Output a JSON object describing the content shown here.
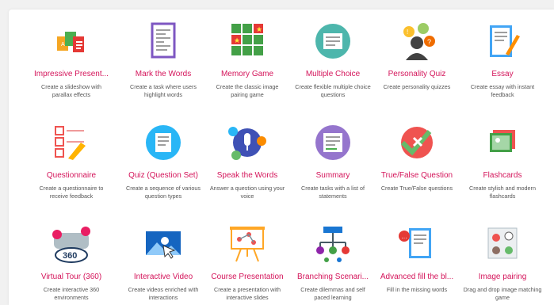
{
  "content_types": [
    {
      "icon": "presentation-icon",
      "title": "Impressive Present...",
      "desc": "Create a slideshow with parallax effects"
    },
    {
      "icon": "mark-words-icon",
      "title": "Mark the Words",
      "desc": "Create a task where users highlight words"
    },
    {
      "icon": "memory-game-icon",
      "title": "Memory Game",
      "desc": "Create the classic image pairing game"
    },
    {
      "icon": "multiple-choice-icon",
      "title": "Multiple Choice",
      "desc": "Create flexible multiple choice questions"
    },
    {
      "icon": "personality-quiz-icon",
      "title": "Personality Quiz",
      "desc": "Create personality quizzes"
    },
    {
      "icon": "essay-icon",
      "title": "Essay",
      "desc": "Create essay with instant feedback"
    },
    {
      "icon": "questionnaire-icon",
      "title": "Questionnaire",
      "desc": "Create a questionnaire to receive feedback"
    },
    {
      "icon": "question-set-icon",
      "title": "Quiz (Question Set)",
      "desc": "Create a sequence of various question types"
    },
    {
      "icon": "speak-words-icon",
      "title": "Speak the Words",
      "desc": "Answer a question using your voice"
    },
    {
      "icon": "summary-icon",
      "title": "Summary",
      "desc": "Create tasks with a list of statements"
    },
    {
      "icon": "true-false-icon",
      "title": "True/False Question",
      "desc": "Create True/False questions"
    },
    {
      "icon": "flashcards-icon",
      "title": "Flashcards",
      "desc": "Create stylish and modern flashcards"
    },
    {
      "icon": "virtual-tour-icon",
      "title": "Virtual Tour (360)",
      "desc": "Create interactive 360 environments"
    },
    {
      "icon": "interactive-video-icon",
      "title": "Interactive Video",
      "desc": "Create videos enriched with interactions"
    },
    {
      "icon": "course-presentation-icon",
      "title": "Course Presentation",
      "desc": "Create a presentation with interactive slides"
    },
    {
      "icon": "branching-scenario-icon",
      "title": "Branching Scenari...",
      "desc": "Create dilemmas and self paced learning"
    },
    {
      "icon": "fill-blanks-icon",
      "title": "Advanced fill the bl...",
      "desc": "Fill in the missing words"
    },
    {
      "icon": "image-pairing-icon",
      "title": "Image pairing",
      "desc": "Drag and drop image matching game"
    }
  ]
}
